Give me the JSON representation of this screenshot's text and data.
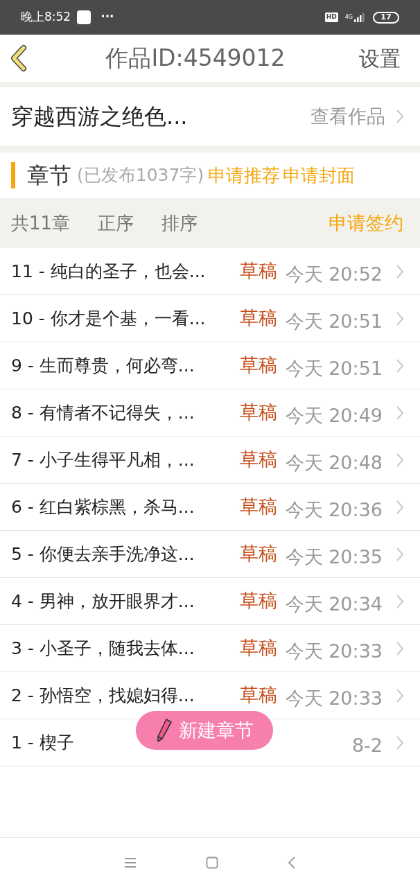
{
  "status_bar": {
    "time": "晚上8:52",
    "dots": "···",
    "hd": "HD",
    "network": "4G",
    "battery": "17"
  },
  "header": {
    "title": "作品ID:4549012",
    "action": "设置"
  },
  "work": {
    "title": "穿越西游之绝色...",
    "link": "查看作品"
  },
  "section": {
    "title": "章节",
    "note": "(已发布1037字)",
    "actions": [
      "申请推荐",
      "申请封面"
    ]
  },
  "toolbar": {
    "count": "共11章",
    "items": [
      "正序",
      "排序"
    ],
    "action": "申请签约"
  },
  "chapters": [
    {
      "title": "11 - 纯白的圣子，也会...",
      "status": "草稿",
      "time": "今天 20:52"
    },
    {
      "title": "10 - 你才是个基，一看...",
      "status": "草稿",
      "time": "今天 20:51"
    },
    {
      "title": "9 - 生而尊贵，何必弯...",
      "status": "草稿",
      "time": "今天 20:51"
    },
    {
      "title": "8 - 有情者不记得失，...",
      "status": "草稿",
      "time": "今天 20:49"
    },
    {
      "title": "7 - 小子生得平凡相，...",
      "status": "草稿",
      "time": "今天 20:48"
    },
    {
      "title": "6 - 红白紫棕黑，杀马...",
      "status": "草稿",
      "time": "今天 20:36"
    },
    {
      "title": "5 - 你便去亲手洗净这...",
      "status": "草稿",
      "time": "今天 20:35"
    },
    {
      "title": "4 - 男神，放开眼界才...",
      "status": "草稿",
      "time": "今天 20:34"
    },
    {
      "title": "3 - 小圣子，随我去体...",
      "status": "草稿",
      "time": "今天 20:33"
    },
    {
      "title": "2 - 孙悟空，找媳妇得...",
      "status": "草稿",
      "time": "今天 20:33"
    },
    {
      "title": "1 - 楔子",
      "time": "8-2"
    }
  ],
  "fab": {
    "label": "新建章节"
  }
}
